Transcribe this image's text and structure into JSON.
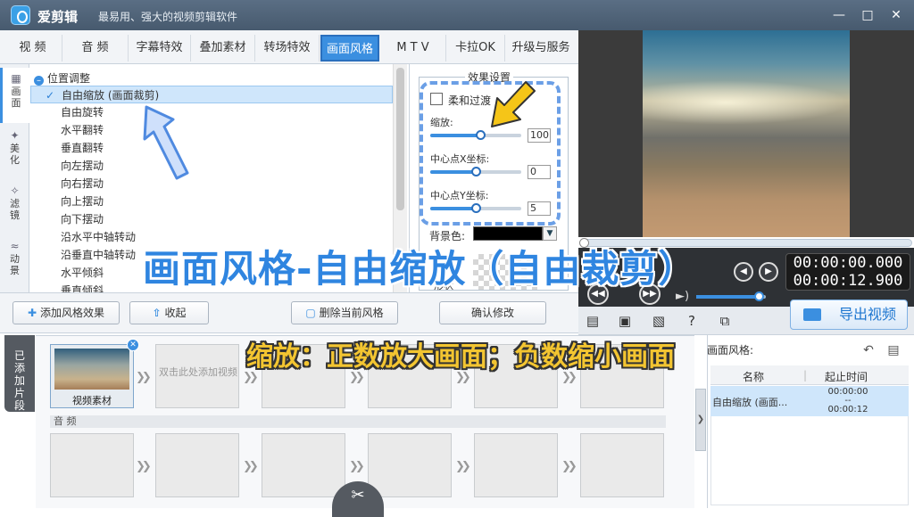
{
  "app": {
    "title": "爱剪辑",
    "slogan": "最易用、强大的视频剪辑软件"
  },
  "tabs": [
    {
      "label": "视 频"
    },
    {
      "label": "音 频"
    },
    {
      "label": "字幕特效"
    },
    {
      "label": "叠加素材"
    },
    {
      "label": "转场特效"
    },
    {
      "label": "画面风格"
    },
    {
      "label": "M T V"
    },
    {
      "label": "卡拉OK"
    },
    {
      "label": "升级与服务"
    }
  ],
  "sidenav": [
    {
      "label": "画面",
      "icon": "film-icon"
    },
    {
      "label": "美化",
      "icon": "magic-wand-icon"
    },
    {
      "label": "滤镜",
      "icon": "filter-wand-icon"
    },
    {
      "label": "动景",
      "icon": "wave-icon"
    }
  ],
  "tree": {
    "root": "位置调整",
    "items": [
      "自由缩放 (画面裁剪)",
      "自由旋转",
      "水平翻转",
      "垂直翻转",
      "向左摆动",
      "向右摆动",
      "向上摆动",
      "向下摆动",
      "沿水平中轴转动",
      "沿垂直中轴转动",
      "水平倾斜",
      "垂直倾斜"
    ],
    "selected_index": 0
  },
  "settings": {
    "title": "效果设置",
    "soft_transition": "柔和过渡",
    "soft_checked": false,
    "scale_label": "缩放:",
    "scale_value": "100",
    "scale_level": 0.55,
    "cx_label": "中心点X坐标:",
    "cx_value": "0",
    "cx_level": 0.5,
    "cy_label": "中心点Y坐标:",
    "cy_value": "5",
    "cy_level": 0.5,
    "bg_label": "背景色:",
    "bg_color": "#000000",
    "shape_label": "形状"
  },
  "actions": {
    "add_style": "添加风格效果",
    "collapse": "收起",
    "delete_style": "删除当前风格",
    "confirm": "确认修改"
  },
  "player": {
    "current_time": "00:00:00.000",
    "total_time": "00:00:12.900",
    "volume_level": 0.9
  },
  "export": {
    "label": "导出视频"
  },
  "timeline": {
    "side_label": "已添加片段",
    "video_clip_caption": "视频素材",
    "add_video_hint": "双击此处添加视频",
    "audio_label": "音 频"
  },
  "style_panel": {
    "title": "画面风格:",
    "col_name": "名称",
    "col_time": "起止时间",
    "rows": [
      {
        "name": "自由缩放 (画面...",
        "start": "00:00:00",
        "sep": "--",
        "end": "00:00:12"
      }
    ]
  },
  "overlay": {
    "title": "画面风格-自由缩放（自由裁剪）",
    "tip": "缩放：正数放大画面；负数缩小画面"
  },
  "colors": {
    "accent": "#3b8fe0",
    "title_overlay": "#2f85e0",
    "tip_overlay": "#f3c531",
    "annotation": "#6b9fe6",
    "arrow_yellow": "#f5c518"
  }
}
